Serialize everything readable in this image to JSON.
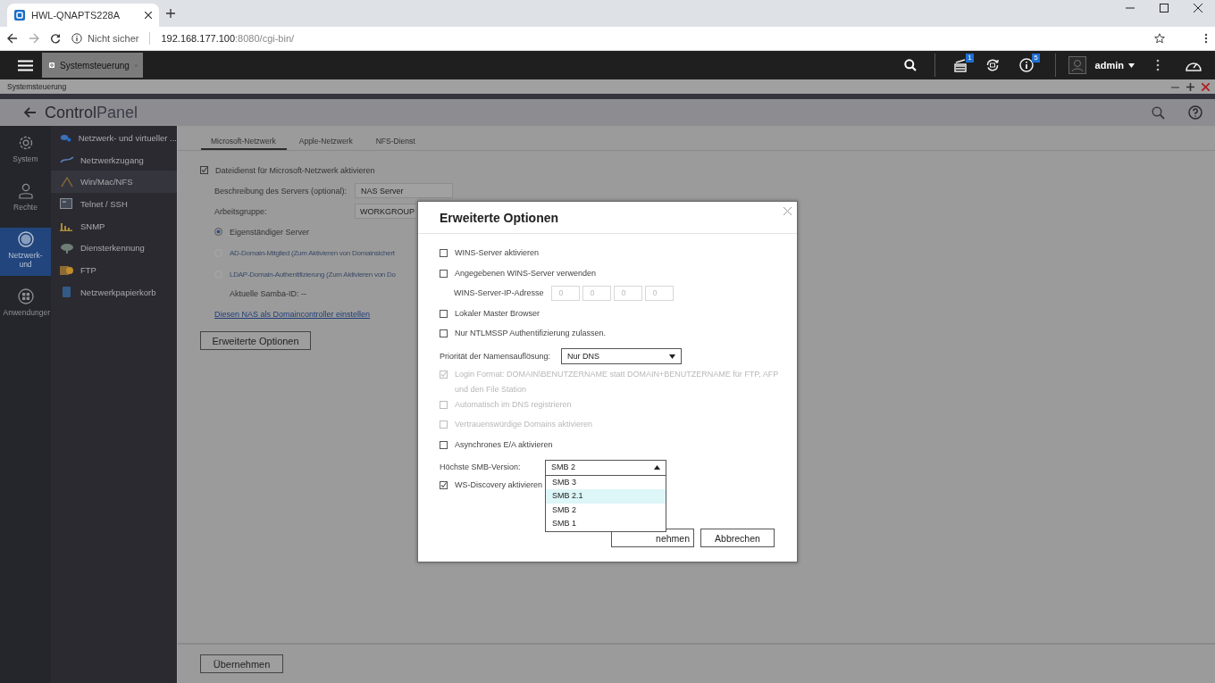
{
  "browser": {
    "tab_title": "HWL-QNAPTS228A",
    "security": "Nicht sicher",
    "host": "192.168.177.100",
    "path": ":8080/cgi-bin/"
  },
  "app_bar": {
    "app_tab": "Systemsteuerung",
    "tasks_badge": "1",
    "info_badge": "5",
    "user": "admin"
  },
  "window": {
    "title": "Systemsteuerung",
    "header_bold": "Control",
    "header_light": "Panel"
  },
  "rail": {
    "items": [
      {
        "label": "System",
        "selected": false
      },
      {
        "label": "Rechte",
        "selected": false
      },
      {
        "label": "Netzwerk- und",
        "selected": true
      },
      {
        "label": "Anwendunger",
        "selected": false
      }
    ]
  },
  "sidebar": {
    "items": [
      {
        "label": "Netzwerk- und virtueller ...",
        "selected": false
      },
      {
        "label": "Netzwerkzugang",
        "selected": false
      },
      {
        "label": "Win/Mac/NFS",
        "selected": true
      },
      {
        "label": "Telnet / SSH",
        "selected": false
      },
      {
        "label": "SNMP",
        "selected": false
      },
      {
        "label": "Diensterkennung",
        "selected": false
      },
      {
        "label": "FTP",
        "selected": false
      },
      {
        "label": "Netzwerkpapierkorb",
        "selected": false
      }
    ]
  },
  "panel": {
    "tabs": [
      {
        "label": "Microsoft-Netzwerk",
        "selected": true
      },
      {
        "label": "Apple-Netzwerk",
        "selected": false
      },
      {
        "label": "NFS-Dienst",
        "selected": false
      }
    ],
    "enable": {
      "label": "Dateidienst für Microsoft-Netzwerk aktivieren",
      "checked": true
    },
    "fields": [
      {
        "label": "Beschreibung des Servers (optional):",
        "value": "NAS Server"
      },
      {
        "label": "Arbeitsgruppe:",
        "value": "WORKGROUP"
      }
    ],
    "radios": [
      {
        "label": "Eigenständiger Server",
        "selected": true,
        "disabled": false
      },
      {
        "label": "AD-Domain-Mitglied (Zum Aktivieren von Domainsichert",
        "selected": false,
        "disabled": true
      },
      {
        "label": "LDAP-Domain-Authentifizierung (Zum Aktivieren von Do",
        "selected": false,
        "disabled": true
      }
    ],
    "samba_id": "Aktuelle Samba-ID: --",
    "link": "Diesen NAS als Domaincontroller einstellen",
    "advanced_button": "Erweiterte Optionen",
    "apply_button": "Übernehmen"
  },
  "dialog": {
    "title": "Erweiterte Optionen",
    "options": [
      {
        "kind": "checkbox",
        "label": "WINS-Server aktivieren",
        "checked": false,
        "disabled": false
      },
      {
        "kind": "checkbox",
        "label": "Angegebenen WINS-Server verwenden",
        "checked": false,
        "disabled": false
      },
      {
        "kind": "ip",
        "label": "WINS-Server-IP-Adresse",
        "octets": [
          "0",
          "0",
          "0",
          "0"
        ]
      },
      {
        "kind": "checkbox",
        "label": "Lokaler Master Browser",
        "checked": false,
        "disabled": false
      },
      {
        "kind": "checkbox",
        "label": "Nur NTLMSSP Authentifizierung zulassen.",
        "checked": false,
        "disabled": false
      },
      {
        "kind": "select",
        "label": "Priorität der Namensauflösung:",
        "value": "Nur DNS",
        "expanded": false
      },
      {
        "kind": "checkbox",
        "label": "Login Format: DOMAIN\\BENUTZERNAME statt DOMAIN+BENUTZERNAME für FTP, AFP und den File Station",
        "checked": true,
        "disabled": true
      },
      {
        "kind": "checkbox",
        "label": "Automatisch im DNS registrieren",
        "checked": false,
        "disabled": true
      },
      {
        "kind": "checkbox",
        "label": "Vertrauenswürdige Domains aktivieren",
        "checked": false,
        "disabled": true
      },
      {
        "kind": "checkbox",
        "label": "Asynchrones E/A aktivieren",
        "checked": false,
        "disabled": false
      },
      {
        "kind": "select",
        "label": "Höchste SMB-Version:",
        "value": "SMB 2",
        "expanded": true,
        "options": [
          {
            "label": "SMB 3",
            "highlighted": false
          },
          {
            "label": "SMB 2.1",
            "highlighted": true
          },
          {
            "label": "SMB 2",
            "highlighted": false
          },
          {
            "label": "SMB 1",
            "highlighted": false
          }
        ]
      },
      {
        "kind": "checkbox",
        "label": "WS-Discovery aktivieren",
        "checked": true,
        "disabled": false
      }
    ],
    "buttons": [
      "nehmen",
      "Abbrechen"
    ]
  }
}
